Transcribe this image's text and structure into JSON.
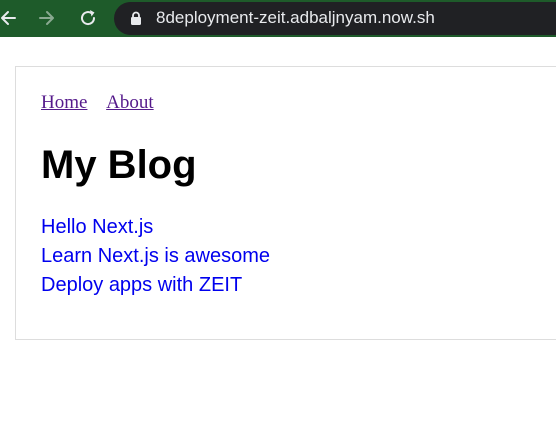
{
  "browser": {
    "url": "8deployment-zeit.adbaljnyam.now.sh",
    "colors": {
      "toolbar": "#1e5b2a",
      "address_bar": "#202124",
      "url_text": "#e8eaed"
    },
    "icons": [
      "back-arrow-icon",
      "forward-arrow-icon",
      "reload-icon",
      "lock-icon"
    ]
  },
  "page": {
    "nav": [
      {
        "label": "Home"
      },
      {
        "label": "About"
      }
    ],
    "title": "My Blog",
    "posts": [
      {
        "title": "Hello Next.js"
      },
      {
        "title": "Learn Next.js is awesome"
      },
      {
        "title": "Deploy apps with ZEIT"
      }
    ],
    "colors": {
      "visited_link": "#551a8b",
      "link": "#0000ee",
      "border": "#dddddd"
    }
  }
}
